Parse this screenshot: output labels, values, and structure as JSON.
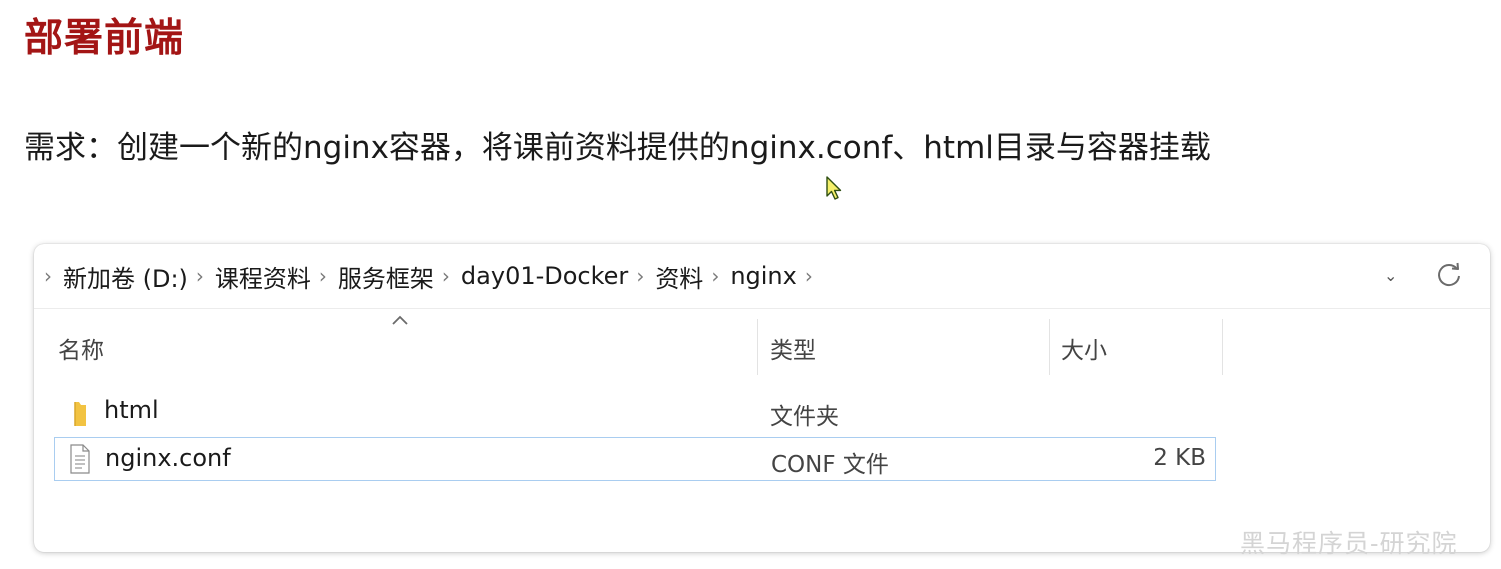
{
  "slide": {
    "title": "部署前端",
    "requirement": "需求：创建一个新的nginx容器，将课前资料提供的nginx.conf、html目录与容器挂载"
  },
  "explorer": {
    "breadcrumb": [
      "新加卷 (D:)",
      "课程资料",
      "服务框架",
      "day01-Docker",
      "资料",
      "nginx"
    ],
    "columns": {
      "name": "名称",
      "type": "类型",
      "size": "大小"
    },
    "rows": [
      {
        "name": "html",
        "type": "文件夹",
        "size": "",
        "icon": "folder-icon"
      },
      {
        "name": "nginx.conf",
        "type": "CONF 文件",
        "size": "2 KB",
        "icon": "file-icon",
        "selected": true
      }
    ]
  },
  "watermark": "黑马程序员-研究院",
  "colors": {
    "title": "#a31515",
    "folder": "#f2c342",
    "selection_border": "#a9cdf0"
  }
}
